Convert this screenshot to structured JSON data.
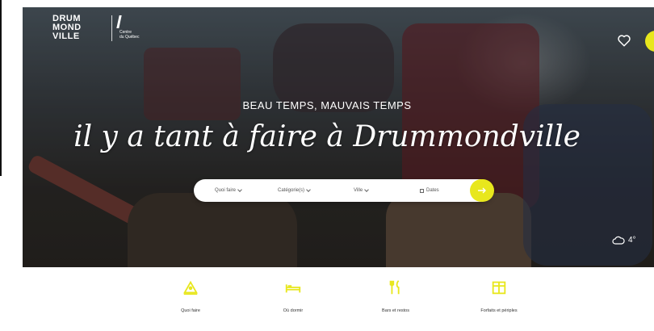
{
  "brand": {
    "logo_line1": "DRUM",
    "logo_line2": "MOND",
    "logo_line3": "VILLE",
    "partner_line1": "Centre",
    "partner_line2": "du Québec",
    "accent_color": "#e8e71d"
  },
  "header": {
    "favorites_icon": "heart-icon",
    "account_icon": "avatar"
  },
  "hero": {
    "eyebrow": "BEAU TEMPS, MAUVAIS TEMPS",
    "headline": "il y a tant à faire à Drummondville"
  },
  "search": {
    "fields": [
      {
        "label": "Quoi faire"
      },
      {
        "label": "Catégorie(s)"
      },
      {
        "label": "Ville"
      },
      {
        "label": "Dates"
      }
    ],
    "submit_icon": "arrow-right-icon"
  },
  "weather": {
    "icon": "cloud-icon",
    "temperature": "4°"
  },
  "nav": {
    "items": [
      {
        "label": "Quoi faire",
        "icon": "activities-icon"
      },
      {
        "label": "Où dormir",
        "icon": "bed-icon"
      },
      {
        "label": "Bars et restos",
        "icon": "utensils-icon"
      },
      {
        "label": "Forfaits et périples",
        "icon": "package-icon"
      }
    ]
  }
}
